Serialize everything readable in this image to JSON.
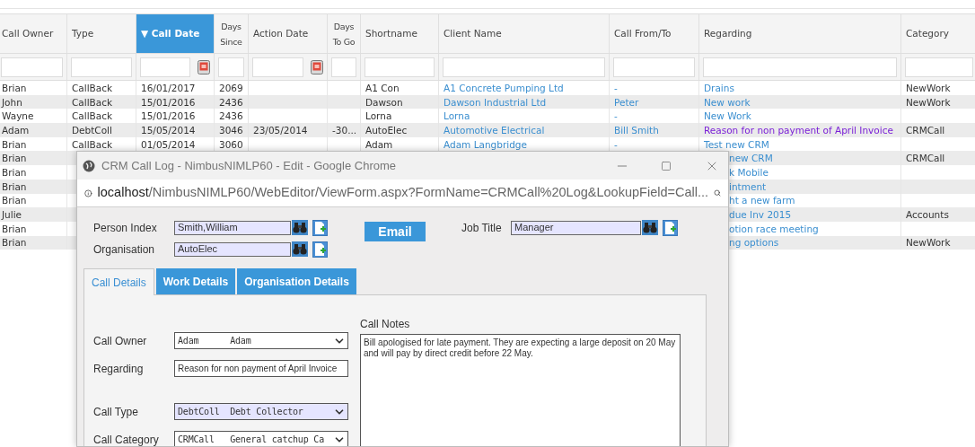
{
  "table": {
    "columns": [
      {
        "label": "Call Owner",
        "sorted": false,
        "date_filter": false
      },
      {
        "label": "Type",
        "sorted": false,
        "date_filter": false
      },
      {
        "label": "▼ Call Date",
        "sorted": true,
        "date_filter": true
      },
      {
        "label": "Days Since",
        "sorted": false,
        "date_filter": false
      },
      {
        "label": "Action Date",
        "sorted": false,
        "date_filter": true
      },
      {
        "label": "Days To Go",
        "sorted": false,
        "date_filter": false
      },
      {
        "label": "Shortname",
        "sorted": false,
        "date_filter": false
      },
      {
        "label": "Client Name",
        "sorted": false,
        "date_filter": false
      },
      {
        "label": "Call From/To",
        "sorted": false,
        "date_filter": false
      },
      {
        "label": "Regarding",
        "sorted": false,
        "date_filter": false
      },
      {
        "label": "Category",
        "sorted": false,
        "date_filter": false
      }
    ],
    "rows": [
      {
        "owner": "Brian",
        "type": "CallBack",
        "call_date": "16/01/2017",
        "days_since": "2069",
        "shortname": "A1 Con",
        "client": "A1 Concrete Pumping Ltd",
        "call_from": "-",
        "regarding": "Drains",
        "visited": false,
        "category": "NewWork"
      },
      {
        "owner": "John",
        "type": "CallBack",
        "call_date": "15/01/2016",
        "days_since": "2436",
        "shortname": "Dawson",
        "client": "Dawson Industrial Ltd",
        "call_from": "Peter",
        "regarding": "New work",
        "visited": false,
        "category": "NewWork"
      },
      {
        "owner": "Wayne",
        "type": "CallBack",
        "call_date": "15/01/2016",
        "days_since": "2436",
        "shortname": "Lorna",
        "client": "Lorna",
        "call_from": "-",
        "regarding": "New Work",
        "visited": false
      },
      {
        "owner": "Adam",
        "type": "DebtColl",
        "call_date": "15/05/2014",
        "days_since": "3046",
        "action_date": "23/05/2014",
        "days_to_go": "-30...",
        "shortname": "AutoElec",
        "client": "Automotive Electrical",
        "call_from": "Bill Smith",
        "regarding": "Reason for non payment of April Invoice",
        "visited": true,
        "category": "CRMCall"
      },
      {
        "owner": "Brian",
        "type": "CallBack",
        "call_date": "01/05/2014",
        "days_since": "3060",
        "shortname": "Adam",
        "client": "Adam Langbridge",
        "call_from": "-",
        "regarding": "Test new CRM",
        "visited": false
      },
      {
        "owner": "Brian",
        "regarding_cut": "new CRM",
        "visited": false,
        "category": "CRMCall"
      },
      {
        "owner": "Brian",
        "regarding_cut": "k Mobile",
        "visited": false
      },
      {
        "owner": "Brian",
        "regarding_cut": "intment",
        "visited": false
      },
      {
        "owner": "Brian",
        "regarding_cut": "ht a new farm",
        "visited": false
      },
      {
        "owner": "Julie",
        "regarding_cut": "due Inv 2015",
        "visited": false,
        "category": "Accounts"
      },
      {
        "owner": "Brian",
        "regarding_cut": "otion race meeting",
        "visited": false
      },
      {
        "owner": "Brian",
        "regarding_cut": "ng options",
        "visited": false,
        "category": "NewWork"
      }
    ]
  },
  "popup": {
    "title": "CRM Call Log - NimbusNIMLP60 - Edit - Google Chrome",
    "url_host": "localhost",
    "url_path": "/NimbusNIMLP60/WebEditor/ViewForm.aspx?FormName=CRMCall%20Log&LookupField=Call...",
    "lookups": [
      {
        "label": "Person Index",
        "value": "Smith,William"
      },
      {
        "label": "Organisation",
        "value": "AutoElec"
      }
    ],
    "email_button": "Email",
    "job_title": {
      "label": "Job Title",
      "value": "Manager"
    },
    "tabs": [
      {
        "label": "Call Details",
        "selected": true
      },
      {
        "label": "Work Details",
        "selected": false
      },
      {
        "label": "Organisation Details",
        "selected": false
      }
    ],
    "form": [
      {
        "kind": "select",
        "label": "Call Owner",
        "value": "Adam      Adam",
        "highlighted": false
      },
      {
        "kind": "text",
        "label": "Regarding",
        "value": "Reason for non payment of April Invoice",
        "highlighted": false
      },
      {
        "kind": "select",
        "label": "Call Type",
        "value": "DebtColl  Debt Collector",
        "highlighted": true
      },
      {
        "kind": "select",
        "label": "Call Category",
        "value": "CRMCall   General catchup Ca",
        "highlighted": false
      }
    ],
    "call_notes": {
      "label": "Call Notes",
      "value": "Bill apologised for late payment. They are expecting a large deposit on 20 May and will pay by direct credit before 22 May."
    }
  }
}
